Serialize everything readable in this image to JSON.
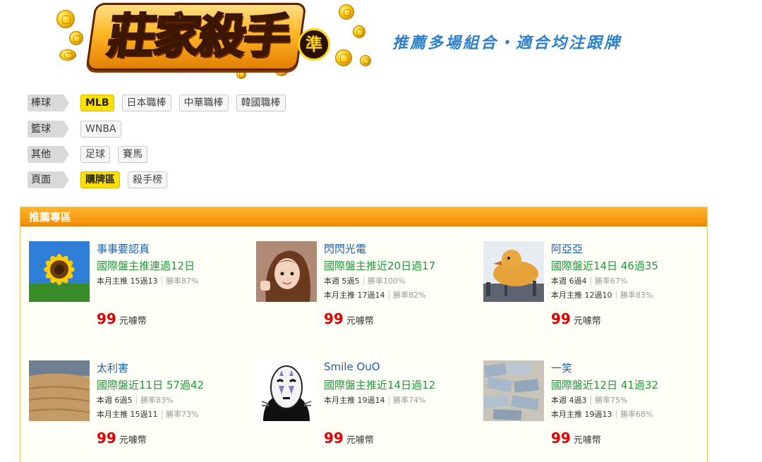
{
  "header": {
    "logo_text": "莊家殺手",
    "logo_badge": "準",
    "slogan": "推薦多場組合・適合均注跟牌"
  },
  "categories": [
    {
      "label": "棒球",
      "items": [
        {
          "text": "MLB",
          "active": true
        },
        {
          "text": "日本職棒",
          "active": false
        },
        {
          "text": "中華職棒",
          "active": false
        },
        {
          "text": "韓國職棒",
          "active": false
        }
      ]
    },
    {
      "label": "籃球",
      "items": [
        {
          "text": "WNBA",
          "active": false
        }
      ]
    },
    {
      "label": "其他",
      "items": [
        {
          "text": "足球",
          "active": false
        },
        {
          "text": "賽馬",
          "active": false
        }
      ]
    },
    {
      "label": "頁面",
      "items": [
        {
          "text": "購牌區",
          "active": true
        },
        {
          "text": "殺手榜",
          "active": false
        }
      ]
    }
  ],
  "panel": {
    "title": "推薦專區",
    "cards": [
      {
        "name": "事事要認真",
        "record": "國際盤主推連過12日",
        "lines": [
          {
            "text": "本月主推 15過13",
            "rate": "勝率87%"
          }
        ],
        "price": "99",
        "unit": "元噱幣",
        "avatar": "sunflower-avatar"
      },
      {
        "name": "閃閃光電",
        "record": "國際盤主推近20日過17",
        "lines": [
          {
            "text": "本週 5過5",
            "rate": "勝率100%"
          },
          {
            "text": "本月主推 17過14",
            "rate": "勝率82%"
          }
        ],
        "price": "99",
        "unit": "元噱幣",
        "avatar": "girl-avatar"
      },
      {
        "name": "阿亞亞",
        "record": "國際盤近14日 46過35",
        "lines": [
          {
            "text": "本週 6過4",
            "rate": "勝率67%"
          },
          {
            "text": "本月主推 12過10",
            "rate": "勝率83%"
          }
        ],
        "price": "99",
        "unit": "元噱幣",
        "avatar": "rubber-duck-avatar"
      },
      {
        "name": "太利害",
        "record": "國際盤近11日 57過42",
        "lines": [
          {
            "text": "本週 6過5",
            "rate": "勝率83%"
          },
          {
            "text": "本月主推 15過11",
            "rate": "勝率73%"
          }
        ],
        "price": "99",
        "unit": "元噱幣",
        "avatar": "wood-avatar"
      },
      {
        "name": "Smile OuO",
        "record": "國際盤主推近14日過12",
        "lines": [
          {
            "text": "本月主推 19過14",
            "rate": "勝率74%"
          }
        ],
        "price": "99",
        "unit": "元噱幣",
        "avatar": "no-face-avatar"
      },
      {
        "name": "一笑",
        "record": "國際盤近12日 41過32",
        "lines": [
          {
            "text": "本週 4過3",
            "rate": "勝率75%"
          },
          {
            "text": "本月主推 19過13",
            "rate": "勝率68%"
          }
        ],
        "price": "99",
        "unit": "元噱幣",
        "avatar": "cash-pile-avatar"
      }
    ]
  }
}
